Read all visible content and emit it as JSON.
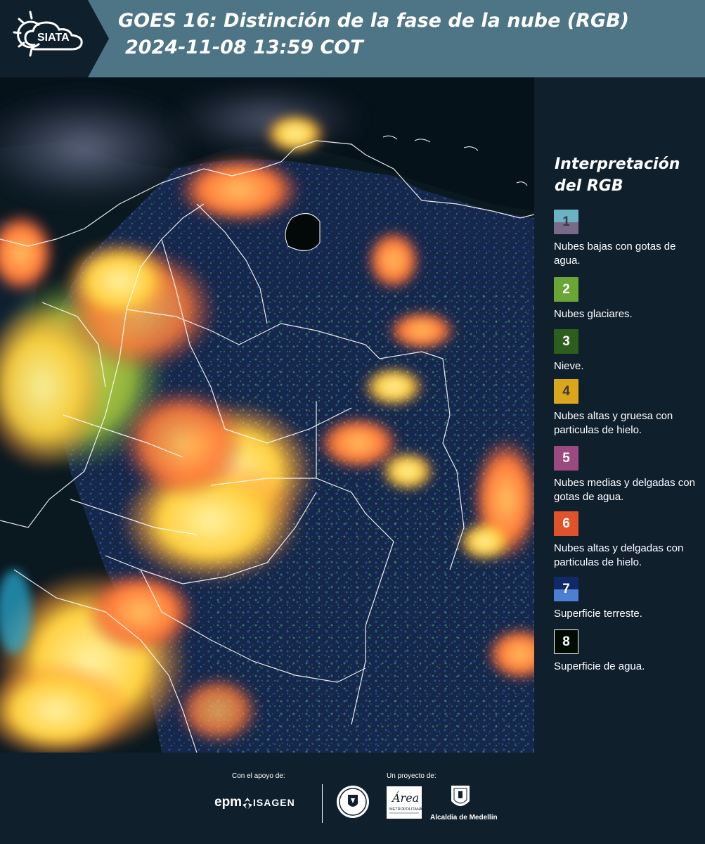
{
  "header": {
    "logo_text": "SIATA",
    "title_line1": "GOES 16: Distinción de la fase de la nube (RGB)",
    "title_line2": "2024-11-08 13:59 COT"
  },
  "legend": {
    "title": "Interpretación del RGB",
    "items": [
      {
        "number": "1",
        "description": "Nubes bajas con gotas de agua.",
        "colors": [
          "#69b3c2",
          "#7a6a8a"
        ],
        "number_color": "#3a3a4a"
      },
      {
        "number": "2",
        "description": "Nubes glaciares.",
        "colors": [
          "#6aa536"
        ],
        "number_color": "#ffffff"
      },
      {
        "number": "3",
        "description": "Nieve.",
        "colors": [
          "#2e5e1e"
        ],
        "number_color": "#ffffff"
      },
      {
        "number": "4",
        "description": "Nubes altas y gruesa con particulas de hielo.",
        "colors": [
          "#d9a61c"
        ],
        "number_color": "#3a3a3a"
      },
      {
        "number": "5",
        "description": "Nubes medias y delgadas con gotas de agua.",
        "colors": [
          "#9b4a7f"
        ],
        "number_color": "#ffffff"
      },
      {
        "number": "6",
        "description": "Nubes altas y delgadas con particulas de hielo.",
        "colors": [
          "#e0522a"
        ],
        "number_color": "#ffffff"
      },
      {
        "number": "7",
        "description": "Superficie terreste.",
        "colors": [
          "#0f2a66",
          "#4d7ed2"
        ],
        "number_color": "#ffffff"
      },
      {
        "number": "8",
        "description": "Superficie de agua.",
        "colors": [
          "#020a04"
        ],
        "number_color": "#ffffff"
      }
    ]
  },
  "footer": {
    "support_label": "Con el apoyo de:",
    "project_label": "Un proyecto de:",
    "epm_text": "epm",
    "isagen_text": "ISAGEN",
    "area_text": "Área",
    "area_subtext": "METROPOLITANA",
    "alcaldia_text": "Alcaldía de Medellín"
  },
  "colors": {
    "header_bg": "#4d7585",
    "page_bg": "#0f1f2c",
    "cloud_yellow": "#ffd84a",
    "cloud_orange": "#ff8a3a",
    "cloud_green": "#a8c83a",
    "land_blue": "#1a3160"
  }
}
